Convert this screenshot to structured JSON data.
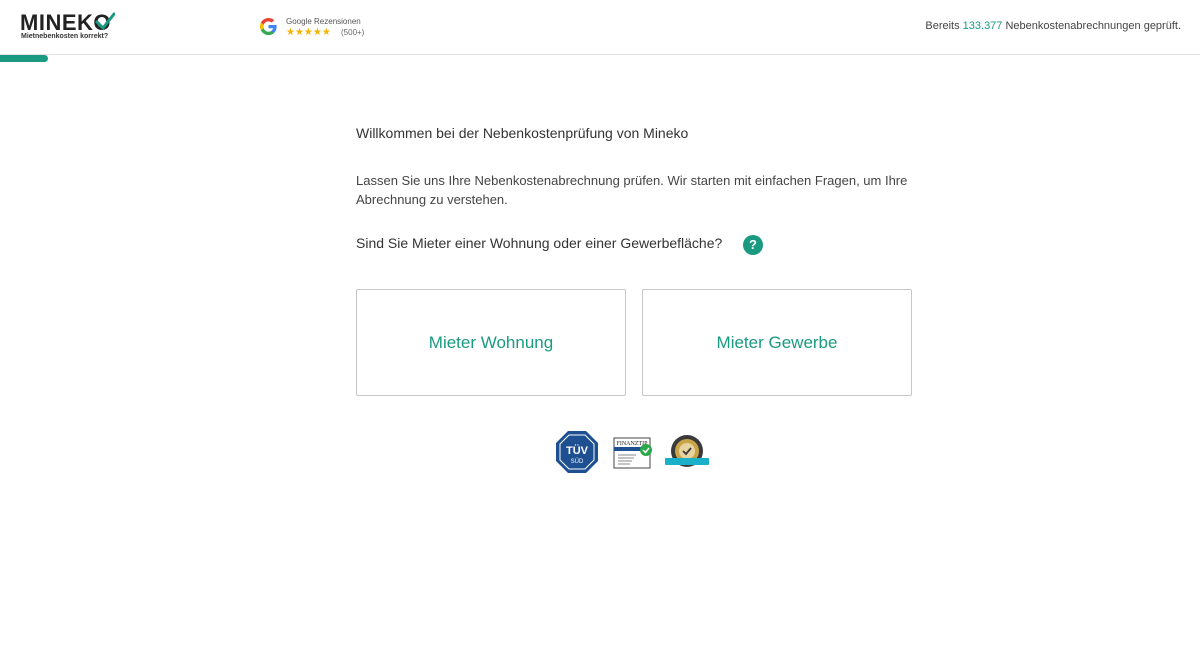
{
  "header": {
    "logo_word": "MINEKO",
    "logo_tagline": "Mietnebenkosten korrekt?",
    "google_label": "Google Rezensionen",
    "google_stars": "★★★★★",
    "google_count": "(500+)",
    "counter_prefix": "Bereits ",
    "counter_number": "133.377",
    "counter_suffix": " Nebenkostenabrechnungen geprüft."
  },
  "progress": {
    "value_fraction": 0.04
  },
  "main": {
    "title": "Willkommen bei der Nebenkostenprüfung von Mineko",
    "intro": "Lassen Sie uns Ihre Nebenkostenabrechnung prüfen. Wir starten mit einfachen Fragen, um Ihre Abrechnung zu verstehen.",
    "question": "Sind Sie Mieter einer Wohnung oder einer Gewerbefläche?",
    "help_glyph": "?",
    "options": [
      {
        "label": "Mieter Wohnung"
      },
      {
        "label": "Mieter Gewerbe"
      }
    ]
  },
  "badges": {
    "tuv_text": "TÜV",
    "tuv_sub": "SÜD",
    "finanztip_text": "FINANZTIP"
  },
  "colors": {
    "accent": "#1a9a80",
    "google_star": "#f5b400",
    "tuv_blue": "#1d4f91"
  },
  "icons": {
    "logo_check": "checkmark-icon",
    "google": "google-g-icon",
    "help": "question-icon"
  }
}
